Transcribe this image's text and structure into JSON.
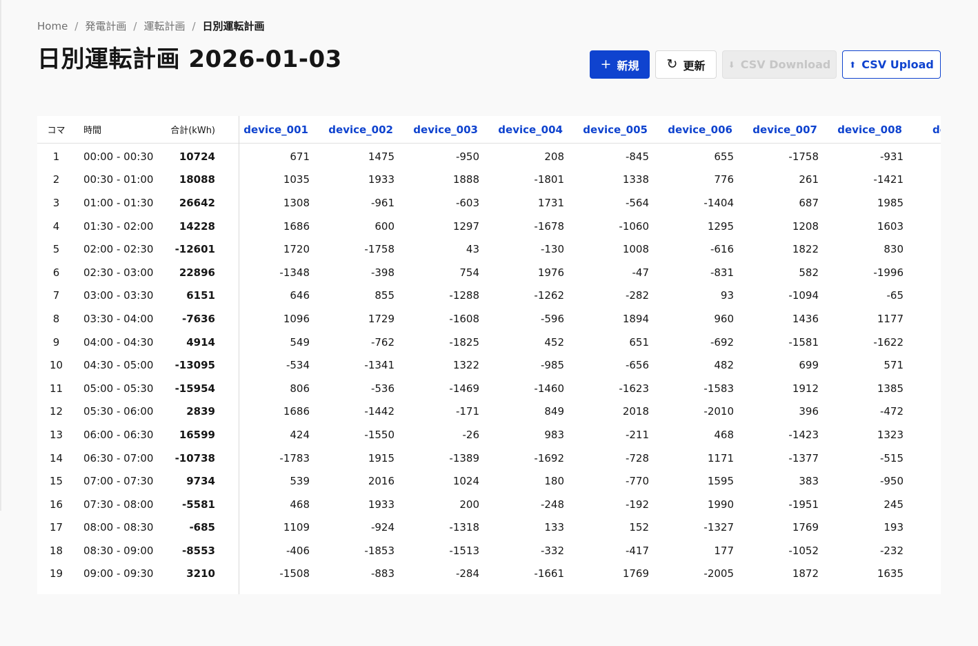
{
  "breadcrumb": [
    "Home",
    "発電計画",
    "運転計画",
    "日別運転計画"
  ],
  "page_title": "日別運転計画 2026-01-03",
  "toolbar": {
    "new_label": "新規",
    "refresh_label": "更新",
    "download_label": "CSV Download",
    "upload_label": "CSV Upload"
  },
  "table": {
    "columns": {
      "koma": "コマ",
      "time": "時間",
      "total": "合計(kWh)"
    },
    "devices": [
      "device_001",
      "device_002",
      "device_003",
      "device_004",
      "device_005",
      "device_006",
      "device_007",
      "device_008",
      "de"
    ],
    "rows": [
      {
        "koma": "1",
        "time": "00:00 - 00:30",
        "total": "10724",
        "values": [
          "671",
          "1475",
          "-950",
          "208",
          "-845",
          "655",
          "-1758",
          "-931"
        ]
      },
      {
        "koma": "2",
        "time": "00:30 - 01:00",
        "total": "18088",
        "values": [
          "1035",
          "1933",
          "1888",
          "-1801",
          "1338",
          "776",
          "261",
          "-1421"
        ]
      },
      {
        "koma": "3",
        "time": "01:00 - 01:30",
        "total": "26642",
        "values": [
          "1308",
          "-961",
          "-603",
          "1731",
          "-564",
          "-1404",
          "687",
          "1985"
        ]
      },
      {
        "koma": "4",
        "time": "01:30 - 02:00",
        "total": "14228",
        "values": [
          "1686",
          "600",
          "1297",
          "-1678",
          "-1060",
          "1295",
          "1208",
          "1603"
        ]
      },
      {
        "koma": "5",
        "time": "02:00 - 02:30",
        "total": "-12601",
        "values": [
          "1720",
          "-1758",
          "43",
          "-130",
          "1008",
          "-616",
          "1822",
          "830"
        ]
      },
      {
        "koma": "6",
        "time": "02:30 - 03:00",
        "total": "22896",
        "values": [
          "-1348",
          "-398",
          "754",
          "1976",
          "-47",
          "-831",
          "582",
          "-1996"
        ]
      },
      {
        "koma": "7",
        "time": "03:00 - 03:30",
        "total": "6151",
        "values": [
          "646",
          "855",
          "-1288",
          "-1262",
          "-282",
          "93",
          "-1094",
          "-65"
        ]
      },
      {
        "koma": "8",
        "time": "03:30 - 04:00",
        "total": "-7636",
        "values": [
          "1096",
          "1729",
          "-1608",
          "-596",
          "1894",
          "960",
          "1436",
          "1177"
        ]
      },
      {
        "koma": "9",
        "time": "04:00 - 04:30",
        "total": "4914",
        "values": [
          "549",
          "-762",
          "-1825",
          "452",
          "651",
          "-692",
          "-1581",
          "-1622"
        ]
      },
      {
        "koma": "10",
        "time": "04:30 - 05:00",
        "total": "-13095",
        "values": [
          "-534",
          "-1341",
          "1322",
          "-985",
          "-656",
          "482",
          "699",
          "571"
        ]
      },
      {
        "koma": "11",
        "time": "05:00 - 05:30",
        "total": "-15954",
        "values": [
          "806",
          "-536",
          "-1469",
          "-1460",
          "-1623",
          "-1583",
          "1912",
          "1385"
        ]
      },
      {
        "koma": "12",
        "time": "05:30 - 06:00",
        "total": "2839",
        "values": [
          "1686",
          "-1442",
          "-171",
          "849",
          "2018",
          "-2010",
          "396",
          "-472"
        ]
      },
      {
        "koma": "13",
        "time": "06:00 - 06:30",
        "total": "16599",
        "values": [
          "424",
          "-1550",
          "-26",
          "983",
          "-211",
          "468",
          "-1423",
          "1323"
        ]
      },
      {
        "koma": "14",
        "time": "06:30 - 07:00",
        "total": "-10738",
        "values": [
          "-1783",
          "1915",
          "-1389",
          "-1692",
          "-728",
          "1171",
          "-1377",
          "-515"
        ]
      },
      {
        "koma": "15",
        "time": "07:00 - 07:30",
        "total": "9734",
        "values": [
          "539",
          "2016",
          "1024",
          "180",
          "-770",
          "1595",
          "383",
          "-950"
        ]
      },
      {
        "koma": "16",
        "time": "07:30 - 08:00",
        "total": "-5581",
        "values": [
          "468",
          "1933",
          "200",
          "-248",
          "-192",
          "1990",
          "-1951",
          "245"
        ]
      },
      {
        "koma": "17",
        "time": "08:00 - 08:30",
        "total": "-685",
        "values": [
          "1109",
          "-924",
          "-1318",
          "133",
          "152",
          "-1327",
          "1769",
          "193"
        ]
      },
      {
        "koma": "18",
        "time": "08:30 - 09:00",
        "total": "-8553",
        "values": [
          "-406",
          "-1853",
          "-1513",
          "-332",
          "-417",
          "177",
          "-1052",
          "-232"
        ]
      },
      {
        "koma": "19",
        "time": "09:00 - 09:30",
        "total": "3210",
        "values": [
          "-1508",
          "-883",
          "-284",
          "-1661",
          "1769",
          "-2005",
          "1872",
          "1635"
        ]
      }
    ]
  }
}
